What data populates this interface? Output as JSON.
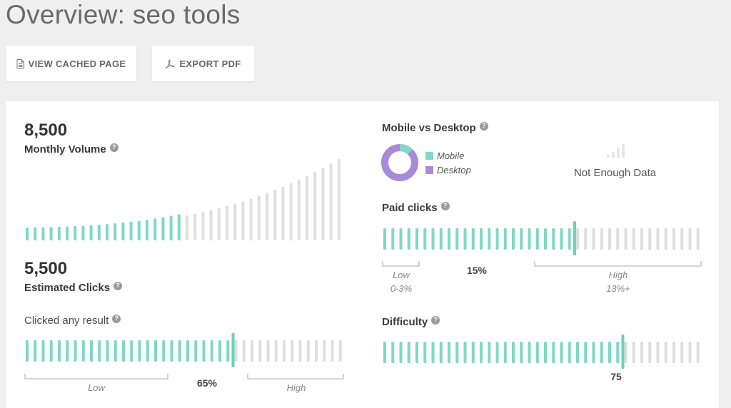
{
  "page": {
    "title": "Overview: seo tools"
  },
  "toolbar": {
    "view_cached_label": "VIEW CACHED PAGE",
    "export_pdf_label": "EXPORT PDF"
  },
  "colors": {
    "active": "#7fd8c6",
    "inactive": "#dedede",
    "marker": "#6fcfbb",
    "mobile": "#7fd8c6",
    "desktop": "#a98ad9"
  },
  "monthly_volume": {
    "value": "8,500",
    "label": "Monthly Volume",
    "help": "?"
  },
  "estimated_clicks": {
    "value": "5,500",
    "label": "Estimated Clicks",
    "help": "?"
  },
  "clicked_any_result": {
    "label": "Clicked any result",
    "help": "?",
    "percent": "65%",
    "level": 0.65,
    "low_label": "Low",
    "high_label": "High"
  },
  "mobile_vs_desktop": {
    "label": "Mobile vs Desktop",
    "help": "?",
    "legend": [
      {
        "name": "Mobile",
        "color": "#7fd8c6"
      },
      {
        "name": "Desktop",
        "color": "#a98ad9"
      }
    ],
    "mobile_share": 0.12,
    "desktop_share": 0.88,
    "not_enough_data": "Not Enough Data",
    "signal_icon": "signal-bars-icon"
  },
  "paid_clicks": {
    "label": "Paid clicks",
    "help": "?",
    "percent": "15%",
    "level": 0.6,
    "low_label": "Low",
    "low_range": "0-3%",
    "high_label": "High",
    "high_range": "13%+"
  },
  "difficulty": {
    "label": "Difficulty",
    "help": "?",
    "value": "75",
    "level": 0.75
  },
  "chart_data": {
    "type": "bar",
    "title": "Monthly Volume",
    "values": [
      1,
      1,
      1,
      1,
      1,
      1,
      1,
      1,
      1,
      1,
      1,
      1,
      1,
      1,
      1,
      1,
      1,
      1,
      1,
      1,
      1,
      1,
      1,
      1,
      1,
      1,
      1,
      1,
      1,
      1,
      1,
      1,
      1,
      1,
      1,
      1,
      1,
      1,
      1,
      1,
      1,
      1,
      1,
      1,
      1,
      1,
      1,
      1,
      1,
      1
    ],
    "note_bars": 40,
    "filled_fraction": 0.5
  }
}
